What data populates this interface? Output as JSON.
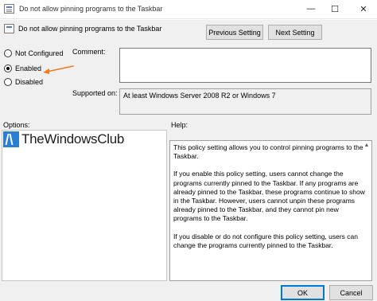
{
  "window": {
    "title": "Do not allow pinning programs to the Taskbar",
    "minimize_glyph": "—",
    "maximize_glyph": "☐",
    "close_glyph": "✕"
  },
  "header": {
    "title": "Do not allow pinning programs to the Taskbar",
    "previous_label": "Previous Setting",
    "next_label": "Next Setting"
  },
  "state": {
    "options": [
      {
        "label": "Not Configured",
        "checked": false
      },
      {
        "label": "Enabled",
        "checked": true
      },
      {
        "label": "Disabled",
        "checked": false
      }
    ]
  },
  "comment": {
    "label": "Comment:",
    "value": ""
  },
  "supported": {
    "label": "Supported on:",
    "value": "At least Windows Server 2008 R2 or Windows 7"
  },
  "options_pane": {
    "label": "Options:"
  },
  "help_pane": {
    "label": "Help:",
    "paragraphs": [
      "This policy setting allows you to control pinning programs to the Taskbar.",
      "If you enable this policy setting, users cannot change the programs currently pinned to the Taskbar. If any programs are already pinned to the Taskbar, these programs continue to show in the Taskbar. However, users cannot unpin these programs already pinned to the Taskbar, and they cannot pin new programs to the Taskbar.",
      "If you disable or do not configure this policy setting, users can change the programs currently pinned to the Taskbar."
    ]
  },
  "footer": {
    "ok_label": "OK",
    "cancel_label": "Cancel"
  },
  "watermark": {
    "text": "TheWindowsClub"
  },
  "colors": {
    "arrow": "#f07b1d",
    "focus_border": "#0078d7",
    "dialog_bg": "#f0f0f0"
  }
}
